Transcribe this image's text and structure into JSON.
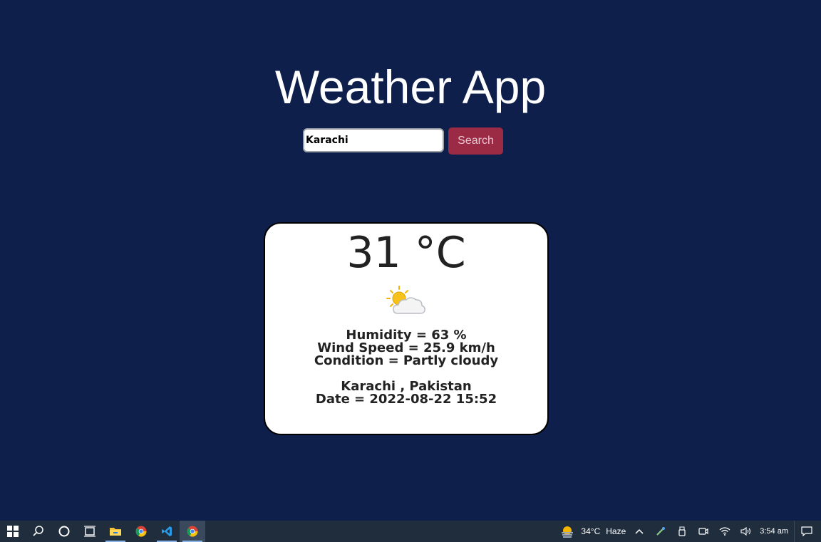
{
  "app": {
    "title": "Weather App"
  },
  "search": {
    "value": "Karachi",
    "button_label": "Search"
  },
  "weather": {
    "temperature": "31 °C",
    "icon": "partly-cloudy-icon",
    "humidity": "Humidity = 63 %",
    "wind": "Wind Speed = 25.9 km/h",
    "condition": "Condition = Partly cloudy",
    "location": "Karachi , Pakistan",
    "date": "Date = 2022-08-22 15:52"
  },
  "taskbar": {
    "apps": [
      "start-icon",
      "search-icon",
      "cortana-icon",
      "task-view-icon",
      "file-explorer-icon",
      "chrome-icon",
      "vscode-icon",
      "chrome-icon"
    ],
    "weather_temp": "34°C",
    "weather_desc": "Haze",
    "clock": "3:54 am"
  },
  "colors": {
    "background": "#0d1f4a",
    "search_button": "#9b2a45",
    "card": "#ffffff"
  }
}
